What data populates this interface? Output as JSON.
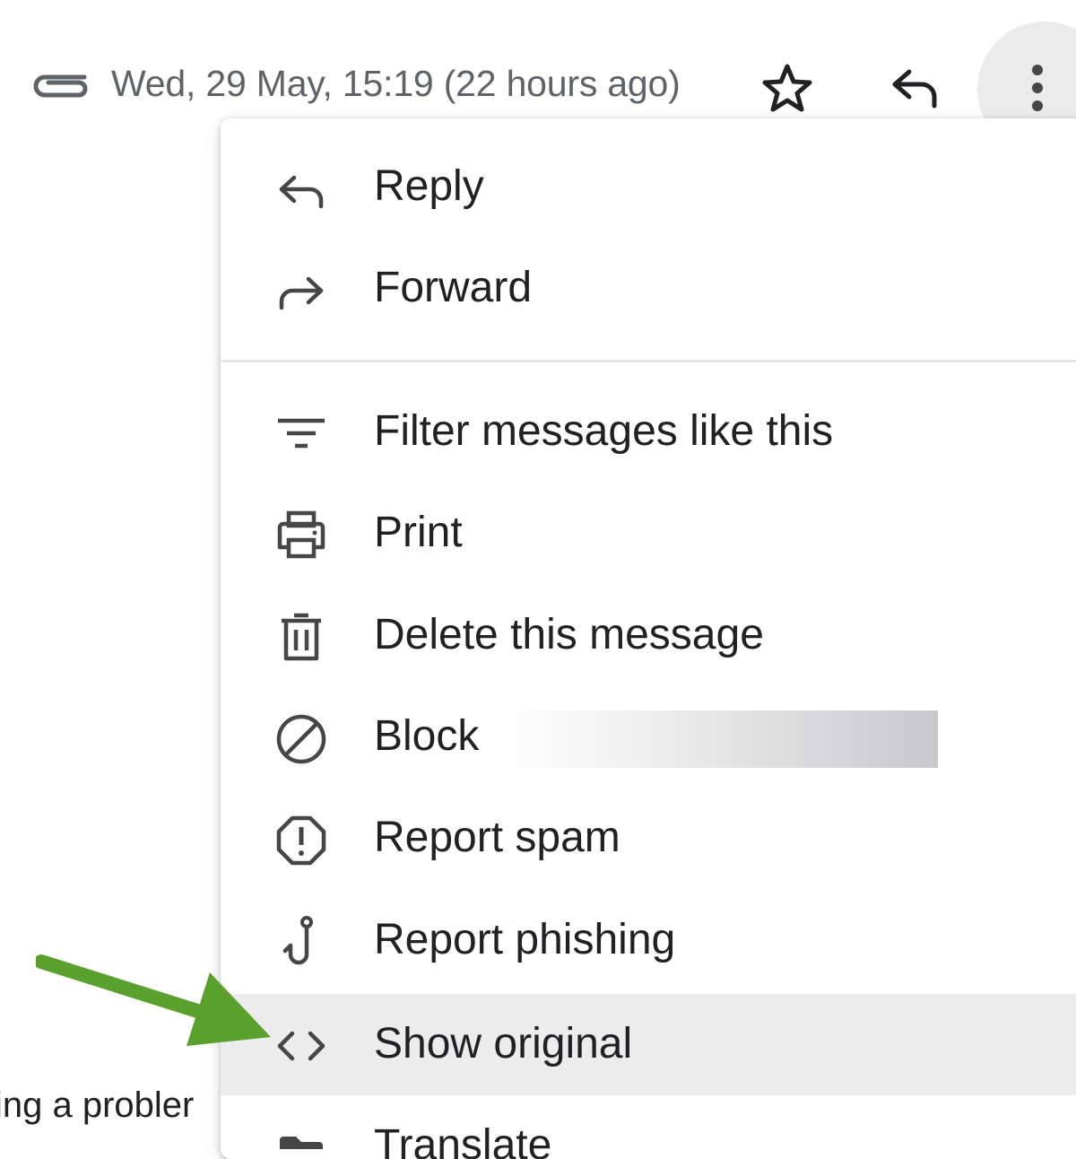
{
  "header": {
    "date": "Wed, 29 May, 15:19 (22 hours ago)"
  },
  "background": {
    "snippet": "ing a probler"
  },
  "menu": {
    "items": [
      {
        "label": "Reply",
        "icon": "reply-icon"
      },
      {
        "label": "Forward",
        "icon": "forward-icon"
      },
      {
        "label": "Filter messages like this",
        "icon": "filter-icon"
      },
      {
        "label": "Print",
        "icon": "print-icon"
      },
      {
        "label": "Delete this message",
        "icon": "trash-icon"
      },
      {
        "label": "Block",
        "icon": "block-icon"
      },
      {
        "label": "Report spam",
        "icon": "report-spam-icon"
      },
      {
        "label": "Report phishing",
        "icon": "phishing-hook-icon"
      },
      {
        "label": "Show original",
        "icon": "code-icon"
      },
      {
        "label": "Translate",
        "icon": "folder-icon"
      }
    ],
    "highlighted_item": "Show original"
  },
  "colors": {
    "annotation_arrow": "#5aa02c",
    "highlight_background": "#ececec",
    "icon": "#444746",
    "secondary_text": "#5f6368"
  }
}
